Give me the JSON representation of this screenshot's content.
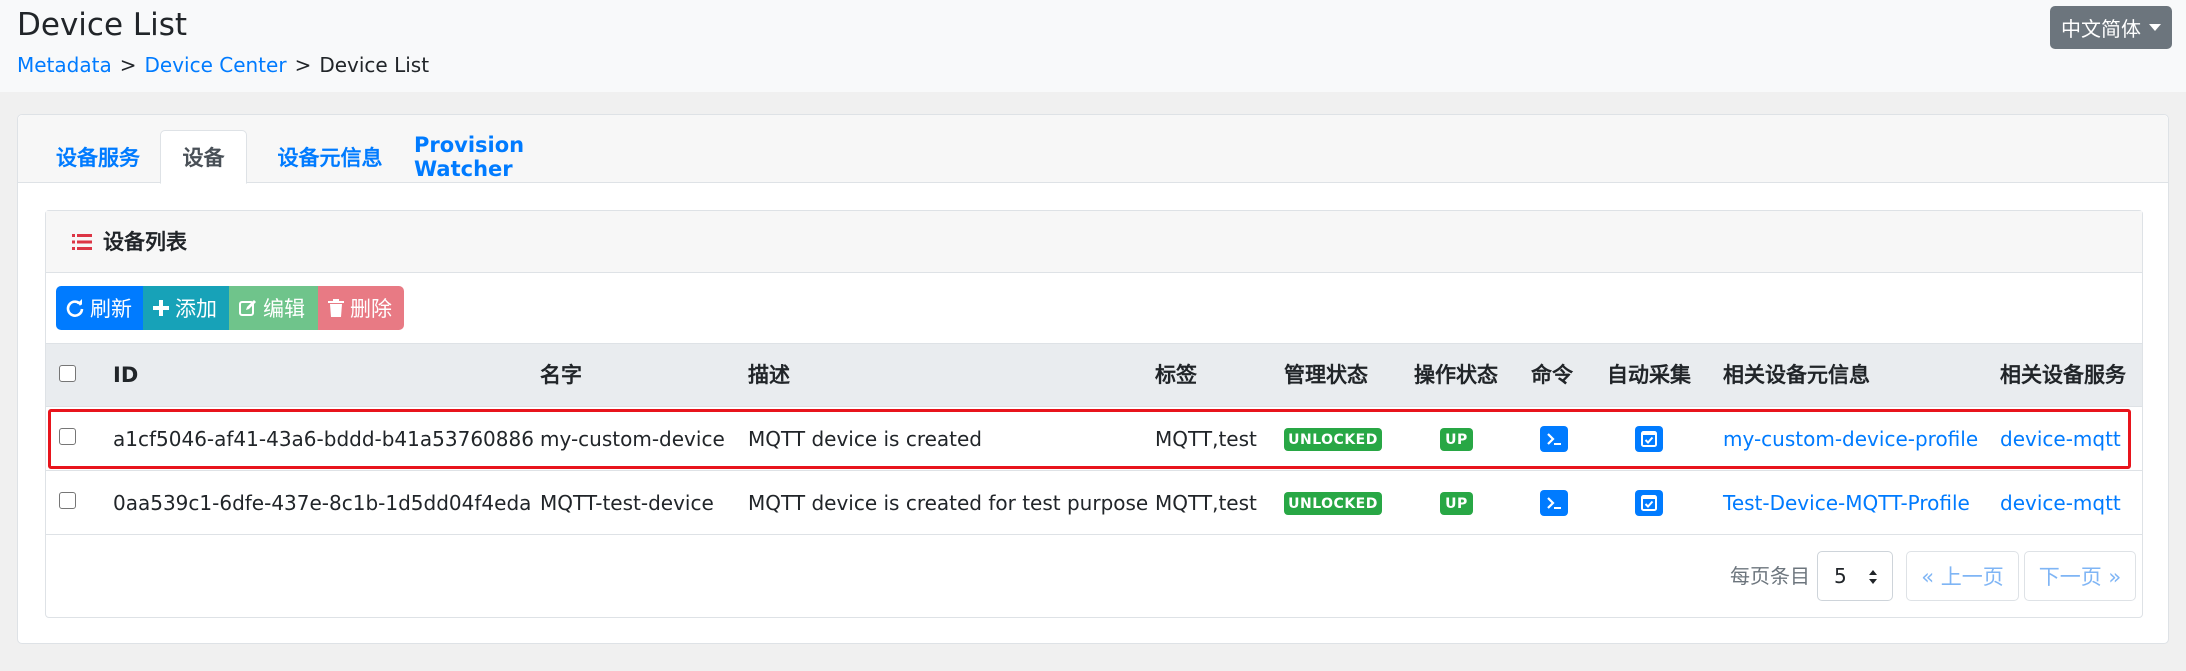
{
  "header": {
    "title": "Device List",
    "lang_label": "中文简体",
    "breadcrumb": [
      {
        "label": "Metadata"
      },
      {
        "label": "Device Center"
      },
      {
        "label": "Device List"
      }
    ],
    "sep": ">"
  },
  "tabs": [
    {
      "label": "设备服务",
      "active": false
    },
    {
      "label": "设备",
      "active": true
    },
    {
      "label": "设备元信息",
      "active": false
    },
    {
      "label": "Provision Watcher",
      "active": false
    }
  ],
  "panel": {
    "title": "设备列表",
    "icon": "list-icon"
  },
  "toolbar": {
    "refresh_label": "刷新",
    "add_label": "添加",
    "edit_label": "编辑",
    "delete_label": "删除"
  },
  "table": {
    "columns": [
      "ID",
      "名字",
      "描述",
      "标签",
      "管理状态",
      "操作状态",
      "命令",
      "自动采集",
      "相关设备元信息",
      "相关设备服务"
    ],
    "rows": [
      {
        "id": "a1cf5046-af41-43a6-bddd-b41a53760886",
        "name": "my-custom-device",
        "description": "MQTT device is created",
        "labels": "MQTT,test",
        "admin_state": "UNLOCKED",
        "op_state": "UP",
        "profile": "my-custom-device-profile",
        "service": "device-mqtt",
        "highlighted": true
      },
      {
        "id": "0aa539c1-6dfe-437e-8c1b-1d5dd04f4eda",
        "name": "MQTT-test-device",
        "description": "MQTT device is created for test purpose",
        "labels": "MQTT,test",
        "admin_state": "UNLOCKED",
        "op_state": "UP",
        "profile": "Test-Device-MQTT-Profile",
        "service": "device-mqtt",
        "highlighted": false
      }
    ]
  },
  "pagination": {
    "per_page_label": "每页条目",
    "per_page_value": "5",
    "prev_label": "« 上一页",
    "next_label": "下一页 »"
  },
  "colors": {
    "primary": "#007bff",
    "success": "#28a745",
    "info": "#17a2b8",
    "highlight": "#e8141c"
  }
}
